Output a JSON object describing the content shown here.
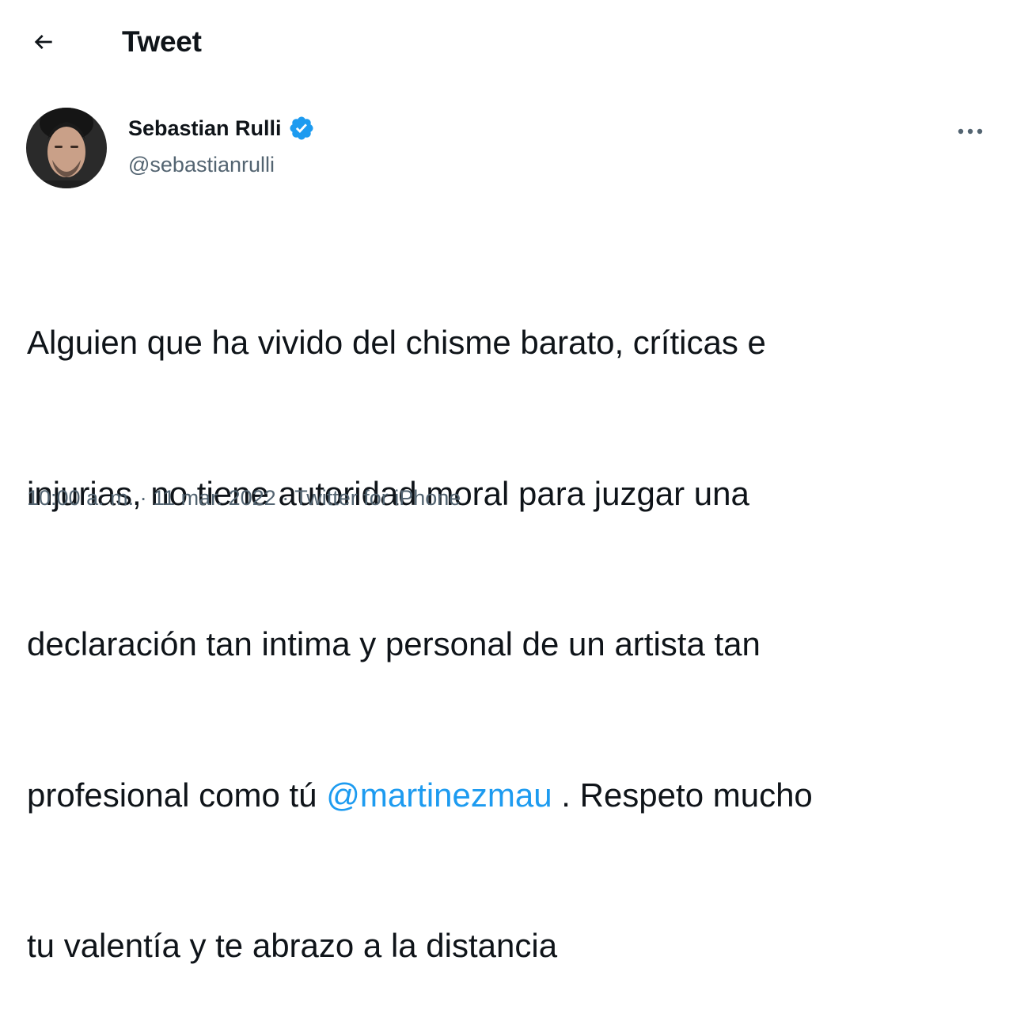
{
  "header": {
    "back_icon": "arrow-left-icon",
    "title": "Tweet"
  },
  "author": {
    "display_name": "Sebastian Rulli",
    "handle": "@sebastianrulli",
    "verified_icon": "verified-badge-icon",
    "more_icon": "more-horizontal-icon"
  },
  "tweet": {
    "text_line1": "Alguien que ha vivido del chisme barato, críticas e",
    "text_line2": "injurias, no tiene autoridad moral para juzgar una",
    "text_line3": "declaración tan intima y personal de un artista tan",
    "text_line4_before": "profesional como tú ",
    "mention": "@martinezmau",
    "text_line4_after": " . Respeto mucho",
    "text_line5": "tu valentía y te abrazo a la distancia"
  },
  "meta": {
    "time": "10:00 a. m.",
    "separator1": " · ",
    "date": "11 mar. 2022",
    "separator2": " · ",
    "source": "Twitter for iPhone"
  },
  "colors": {
    "accent": "#1d9bf0",
    "text_primary": "#0f1419",
    "text_secondary": "#536471",
    "background": "#ffffff"
  }
}
